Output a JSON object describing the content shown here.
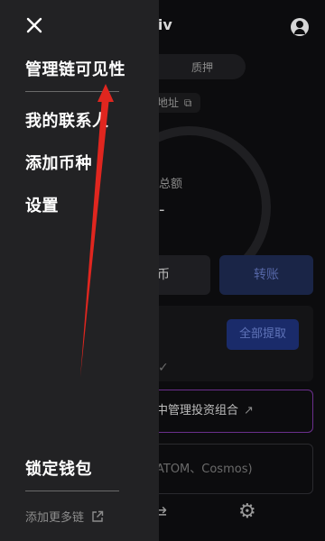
{
  "background": {
    "title": "npiv",
    "segment": {
      "pledge": "质押"
    },
    "address_label": "地址",
    "total_label": "总额",
    "total_value": "-",
    "buttons": {
      "receive": "币",
      "transfer": "转账",
      "withdraw_all": "全部提取"
    },
    "manage_portfolio": "中管理投资组合",
    "chain_name": "ATOM、Cosmos)"
  },
  "drawer": {
    "items": [
      {
        "label": "管理链可见性"
      },
      {
        "label": "我的联系人"
      },
      {
        "label": "添加币种"
      },
      {
        "label": "设置"
      }
    ],
    "lock_wallet": "锁定钱包",
    "add_more_chains": "添加更多链"
  },
  "colors": {
    "drawer_bg": "#222224",
    "annotation_arrow": "#e0261f",
    "accent_blue": "#1a2b6a",
    "accent_purple": "#6b2f8e"
  },
  "icons": [
    "close-icon",
    "external-link-icon",
    "user-icon",
    "copy-icon",
    "check-icon",
    "transfer-icon",
    "gear-icon"
  ]
}
